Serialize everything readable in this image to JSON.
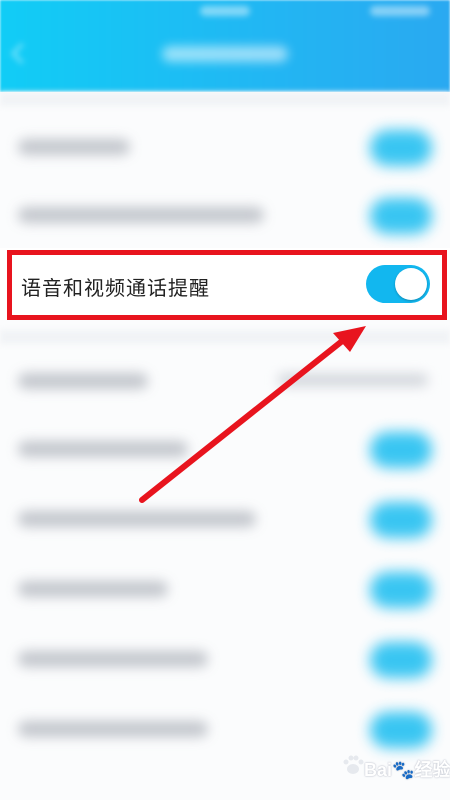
{
  "highlighted_setting": {
    "label": "语音和视频通话提醒",
    "enabled": true
  },
  "watermark": {
    "text": "Bai🐾经验"
  },
  "colors": {
    "header": "#22b6f3",
    "toggle_on": "#12b7ef",
    "highlight_border": "#e8141e",
    "arrow": "#e8141e"
  }
}
